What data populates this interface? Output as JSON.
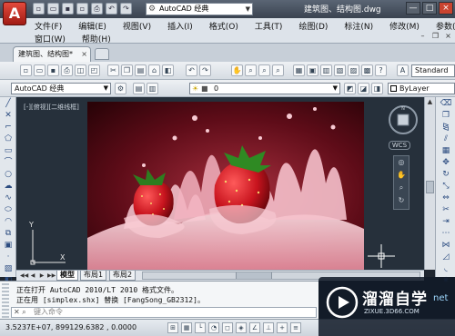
{
  "titlebar": {
    "app_button_letter": "A",
    "workspace": "AutoCAD 经典",
    "title": "建筑图、结构图.dwg",
    "window_controls": [
      "—",
      "□",
      "×"
    ]
  },
  "menu": {
    "row1": [
      "文件(F)",
      "编辑(E)",
      "视图(V)",
      "插入(I)",
      "格式(O)",
      "工具(T)",
      "绘图(D)",
      "标注(N)",
      "修改(M)",
      "参数(P)"
    ],
    "row2": [
      "窗口(W)",
      "帮助(H)"
    ]
  },
  "doc_tab": {
    "label": "建筑图、结构图*"
  },
  "toolbar": {
    "text_style": "Standard",
    "workspace": "AutoCAD 经典",
    "layer": "0",
    "color": "ByLayer"
  },
  "canvas": {
    "viewport_label": "[-][俯视][二维线框]",
    "wcs_label": "WCS",
    "ucs_y": "Y",
    "ucs_x": "X",
    "colors": {
      "background": "#26303b",
      "photo_bg": "#3a0610",
      "strawberry": "#c8141e",
      "milk": "#f7c9d2"
    }
  },
  "layout_tabs": [
    "模型",
    "布局1",
    "布局2"
  ],
  "command": {
    "lines": [
      "正在打开 AutoCAD 2010/LT 2010 格式文件。",
      "正在用 [simplex.shx] 替换 [FangSong_GB2312]。"
    ],
    "placeholder": "键入命令"
  },
  "status": {
    "coords": "3.5237E+07, 899129.6382 , 0.0000"
  },
  "watermark": {
    "title": "溜溜自学",
    "url": "ZIXUE.3D66.COM",
    "suffix": "net"
  }
}
